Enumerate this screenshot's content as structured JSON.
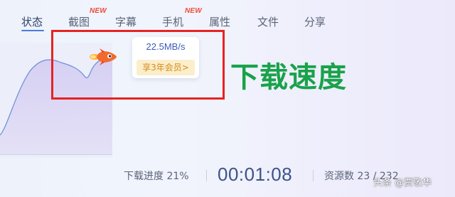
{
  "tabs": [
    {
      "label": "状态",
      "active": true
    },
    {
      "label": "截图",
      "badge": "NEW"
    },
    {
      "label": "字幕"
    },
    {
      "label": "手机",
      "badge": "NEW"
    },
    {
      "label": "属性"
    },
    {
      "label": "文件"
    },
    {
      "label": "分享"
    }
  ],
  "tooltip": {
    "speed": "22.5MB/s",
    "vip_button": "享3年会员>"
  },
  "annotation": {
    "label": "下载速度",
    "label_color": "#19a24a",
    "box_color": "#e52323"
  },
  "status": {
    "progress": "下载进度 21%",
    "elapsed": "00:01:08",
    "sources": "资源数 23 / 232"
  },
  "watermark": "头条 @贾敬华",
  "colors": {
    "accent": "#4a7bd8",
    "speed_text": "#3b5bb8",
    "vip_text": "#d48b1e",
    "vip_bg": "#fbeeca",
    "new_badge": "#f04a3a"
  },
  "icons": {
    "rocket": "rocket-icon"
  }
}
